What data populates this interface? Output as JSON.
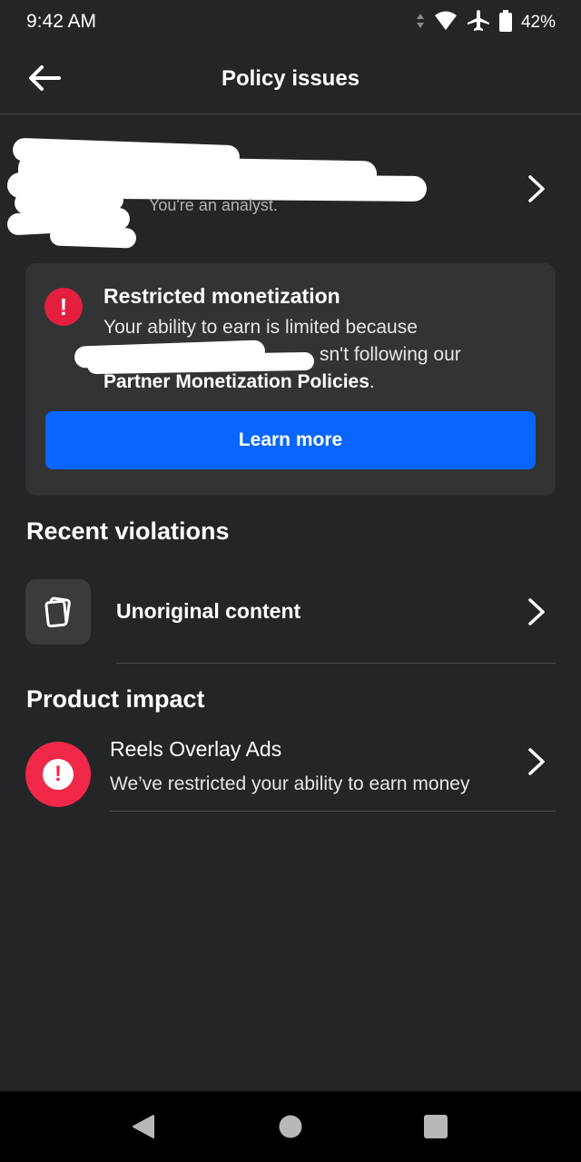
{
  "status_bar": {
    "time": "9:42 AM",
    "battery": "42%",
    "icons": [
      "signal-arrows-icon",
      "wifi-icon",
      "airplane-icon",
      "battery-icon"
    ]
  },
  "header": {
    "title": "Policy issues",
    "back_icon": "arrow-left-icon"
  },
  "profile": {
    "name": "",
    "subtitle": "You're an analyst.",
    "chevron_icon": "chevron-right-icon"
  },
  "alert": {
    "title": "Restricted monetization",
    "body_prefix": "Your ability to earn is limited because",
    "body_middle": "sn't following our",
    "policy_link": "Partner Monetization Policies",
    "body_suffix": ".",
    "button_label": "Learn more",
    "icon": "exclamation-circle-icon",
    "accent_color": "#e41e3f",
    "button_color": "#0866ff"
  },
  "recent_violations": {
    "heading": "Recent violations",
    "items": [
      {
        "label": "Unoriginal content",
        "icon": "copy-pages-icon"
      }
    ]
  },
  "product_impact": {
    "heading": "Product impact",
    "items": [
      {
        "title": "Reels Overlay Ads",
        "description": "We’ve restricted your ability to earn money",
        "icon": "warning-circle-icon",
        "icon_color": "#f02849"
      }
    ]
  },
  "nav_bar": {
    "buttons": [
      "back-triangle-icon",
      "home-circle-icon",
      "recents-square-icon"
    ]
  }
}
